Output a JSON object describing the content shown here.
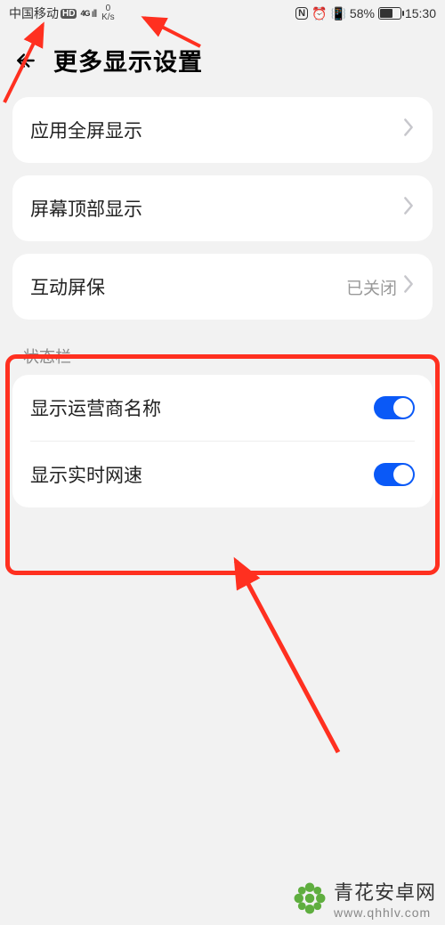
{
  "statusbar": {
    "carrier": "中国移动",
    "hd": "HD",
    "net_gen": "4G",
    "netspeed_num": "0",
    "netspeed_unit": "K/s",
    "nfc": "N",
    "battery_pct": "58%",
    "time": "15:30"
  },
  "header": {
    "title": "更多显示设置"
  },
  "rows": {
    "fullscreen": "应用全屏显示",
    "topdisplay": "屏幕顶部显示",
    "screensaver": "互动屏保",
    "screensaver_value": "已关闭"
  },
  "section": {
    "statusbar_label": "状态栏",
    "show_carrier": "显示运营商名称",
    "show_netspeed": "显示实时网速"
  },
  "watermark": {
    "name": "青花安卓网",
    "url": "www.qhhlv.com"
  }
}
